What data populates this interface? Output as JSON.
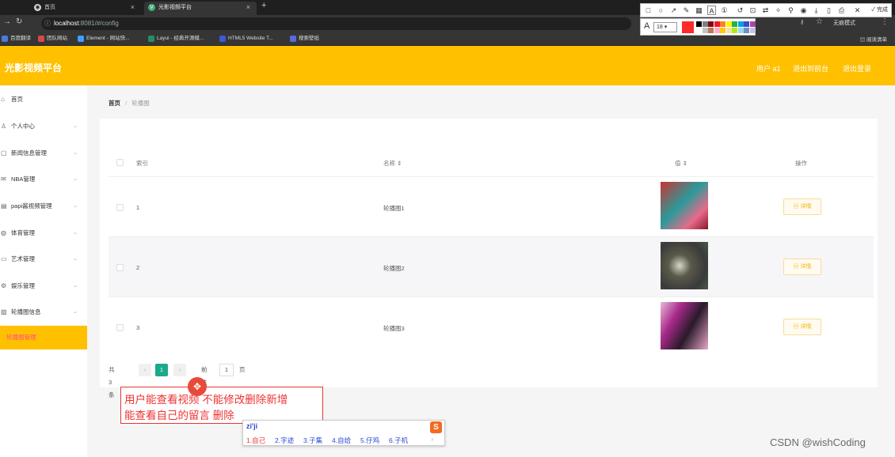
{
  "browser": {
    "tabs": [
      {
        "label": "首页",
        "active": false
      },
      {
        "label": "光影视频平台",
        "active": true
      }
    ],
    "first_tab_label": "首页",
    "url_host": "localhost",
    "url_path": ":8081/#/config",
    "incognito_label": "无痕模式",
    "bookmarks": [
      "百度翻译",
      "团队网站",
      "Element - 网站快...",
      "Layui - 经典开源模...",
      "HTML5 Website T...",
      "搜索壁纸"
    ],
    "reading_list": "阅读清单"
  },
  "snap_toolbar": {
    "done_label": "完成",
    "font_size": "18",
    "font_label": "A",
    "current_color": "#ff2a2a",
    "swatches": [
      "#000000",
      "#7f7f7f",
      "#880015",
      "#ed1c24",
      "#ff7f27",
      "#fff200",
      "#22b14c",
      "#00a2e8",
      "#3f48cc",
      "#a349a4",
      "#ffffff",
      "#c3c3c3",
      "#b97a57",
      "#ffaec9",
      "#ffc90e",
      "#efe4b0",
      "#b5e61d",
      "#99d9ea",
      "#7092be",
      "#c8bfe7"
    ]
  },
  "app": {
    "title": "光影视频平台",
    "header_links": [
      "用户 a1",
      "退出到前台",
      "退出登录"
    ],
    "accent": "#ffc000"
  },
  "sidebar": {
    "items": [
      {
        "label": "首页",
        "icon": "home-icon",
        "has_arrow": false
      },
      {
        "label": "个人中心",
        "icon": "user-icon",
        "has_arrow": true
      },
      {
        "label": "新闻信息管理",
        "icon": "news-icon",
        "has_arrow": true
      },
      {
        "label": "NBA管理",
        "icon": "mail-icon",
        "has_arrow": true
      },
      {
        "label": "papi酱视频管理",
        "icon": "doc-icon",
        "has_arrow": true
      },
      {
        "label": "体育管理",
        "icon": "bulb-icon",
        "has_arrow": true
      },
      {
        "label": "艺术管理",
        "icon": "folder-icon",
        "has_arrow": true
      },
      {
        "label": "娱乐管理",
        "icon": "gear-icon",
        "has_arrow": true
      },
      {
        "label": "轮播图信息",
        "icon": "image-icon",
        "has_arrow": true
      }
    ],
    "active_item": "轮播图管理"
  },
  "breadcrumb": {
    "home": "首页",
    "separator": "/",
    "current": "轮播图"
  },
  "table": {
    "headers": [
      "索引",
      "名称 ⇕",
      "值 ⇕",
      "操作"
    ],
    "rows": [
      {
        "index": "1",
        "name": "轮播图1",
        "action": "详情"
      },
      {
        "index": "2",
        "name": "轮播图2",
        "action": "详情"
      },
      {
        "index": "3",
        "name": "轮播图3",
        "action": "详情"
      }
    ]
  },
  "pagination": {
    "total": "共 3 条",
    "prev": "‹",
    "current": "1",
    "next": "›",
    "goto_label": "前往",
    "goto_value": "1",
    "page_suffix": "页"
  },
  "annotation": {
    "line1": "用户能查看视频 不能修改删除新增",
    "line2": "能查看自己的留言 删除"
  },
  "ime": {
    "input": "zi'ji",
    "candidates": [
      "1.自己",
      "2.字迹",
      "3.子集",
      "4.自给",
      "5.仔鸡",
      "6.子机"
    ],
    "logo": "S",
    "next": "›"
  },
  "watermark": "CSDN @wishCoding"
}
